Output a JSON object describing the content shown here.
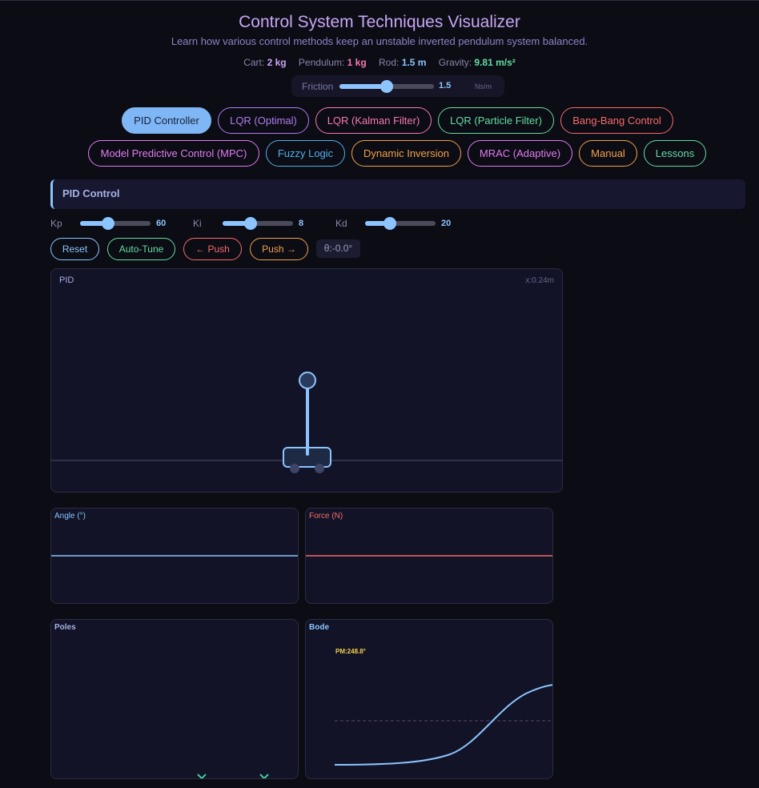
{
  "header": {
    "title": "Control System Techniques Visualizer",
    "subtitle": "Learn how various control methods keep an unstable inverted pendulum system balanced."
  },
  "params": {
    "cart_label": "Cart:",
    "cart_value": "2 kg",
    "pendulum_label": "Pendulum:",
    "pendulum_value": "1 kg",
    "rod_label": "Rod:",
    "rod_value": "1.5 m",
    "gravity_label": "Gravity:",
    "gravity_value": "9.81 m/s²"
  },
  "friction": {
    "label": "Friction",
    "value": "1.5",
    "unit": "Ns/m",
    "level": 0.5
  },
  "tabs": [
    {
      "label": "PID Controller",
      "color": "#7fb6f5",
      "active": true
    },
    {
      "label": "LQR (Optimal)",
      "color": "#b07cf0"
    },
    {
      "label": "LQR (Kalman Filter)",
      "color": "#f57ab0"
    },
    {
      "label": "LQR (Particle Filter)",
      "color": "#62dca0"
    },
    {
      "label": "Bang-Bang Control",
      "color": "#f56b6b"
    },
    {
      "label": "Model Predictive Control (MPC)",
      "color": "#e07cf0"
    },
    {
      "label": "Fuzzy Logic",
      "color": "#4fb0e8"
    },
    {
      "label": "Dynamic Inversion",
      "color": "#f0a24a"
    },
    {
      "label": "MRAC (Adaptive)",
      "color": "#e07cf0"
    },
    {
      "label": "Manual",
      "color": "#f0a24a"
    },
    {
      "label": "Lessons",
      "color": "#62dca0"
    }
  ],
  "section": {
    "title": "PID Control"
  },
  "gains": [
    {
      "label": "Kp",
      "value": "60",
      "level": 0.4
    },
    {
      "label": "Ki",
      "value": "8",
      "level": 0.4
    },
    {
      "label": "Kd",
      "value": "20",
      "level": 0.35
    }
  ],
  "actions": {
    "reset": "Reset",
    "autotune": "Auto-Tune",
    "push_left": "← Push",
    "push_right": "Push →",
    "theta": "θ:-0.0°"
  },
  "sim": {
    "label": "PID",
    "position": "x:0.24m"
  },
  "plots": {
    "angle": "Angle (°)",
    "force": "Force (N)",
    "poles": "Poles",
    "bode": "Bode",
    "phase_margin": "PM:248.8°"
  },
  "colors": {
    "accent": "#8cc4ff",
    "force": "#f56b6b",
    "margin": "#f5d04a",
    "pole": "#3fd0a0"
  }
}
